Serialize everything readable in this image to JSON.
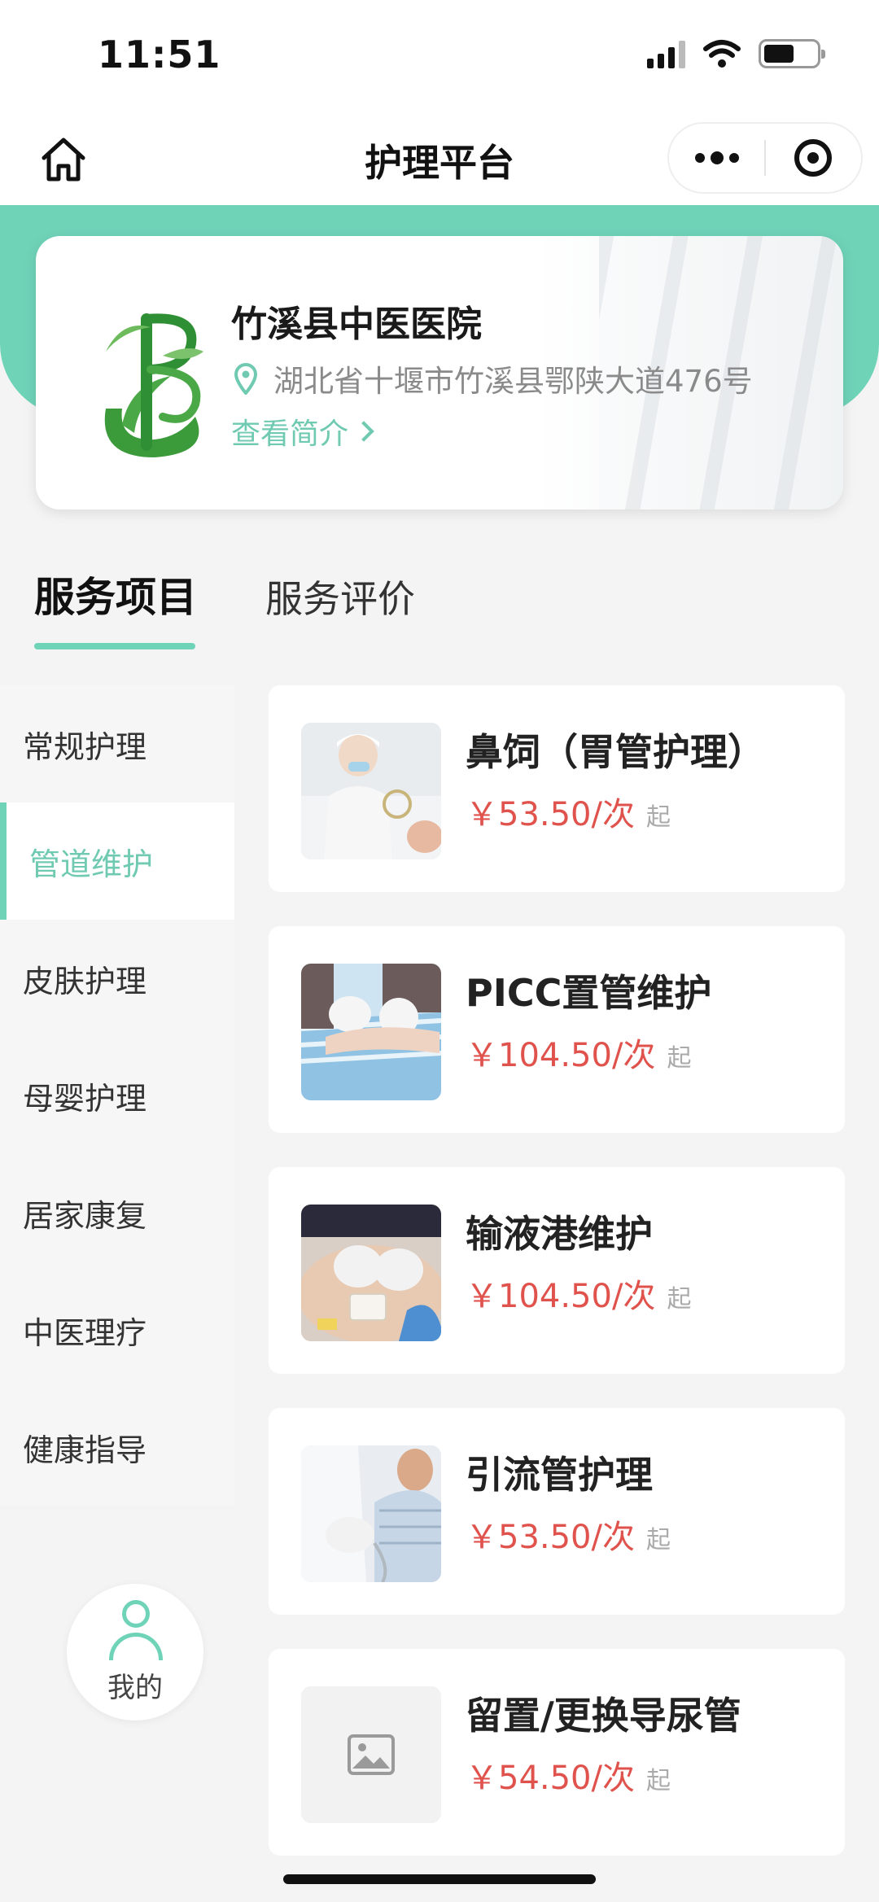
{
  "status_bar": {
    "time": "11:51"
  },
  "nav": {
    "title": "护理平台"
  },
  "hospital": {
    "name": "竹溪县中医医院",
    "address": "湖北省十堰市竹溪县鄂陕大道476号",
    "intro_link": "查看简介"
  },
  "tabs": [
    {
      "label": "服务项目",
      "active": true
    },
    {
      "label": "服务评价",
      "active": false
    }
  ],
  "sidebar": {
    "items": [
      {
        "label": "常规护理"
      },
      {
        "label": "管道维护"
      },
      {
        "label": "皮肤护理"
      },
      {
        "label": "母婴护理"
      },
      {
        "label": "居家康复"
      },
      {
        "label": "中医理疗"
      },
      {
        "label": "健康指导"
      }
    ],
    "active_index": 1
  },
  "my_button": {
    "label": "我的"
  },
  "services": [
    {
      "name": "鼻饲（胃管护理）",
      "price": "￥53.50/次",
      "suffix": "起",
      "image": "nurse-photo"
    },
    {
      "name": "PICC置管维护",
      "price": "￥104.50/次",
      "suffix": "起",
      "image": "picc-photo"
    },
    {
      "name": "输液港维护",
      "price": "￥104.50/次",
      "suffix": "起",
      "image": "port-photo"
    },
    {
      "name": "引流管护理",
      "price": "￥53.50/次",
      "suffix": "起",
      "image": "drain-photo"
    },
    {
      "name": "留置/更换导尿管",
      "price": "￥54.50/次",
      "suffix": "起",
      "image": "image-placeholder-icon"
    }
  ],
  "colors": {
    "accent": "#6fd3b8",
    "accent_text": "#6fcab1",
    "price": "#e0524c"
  }
}
